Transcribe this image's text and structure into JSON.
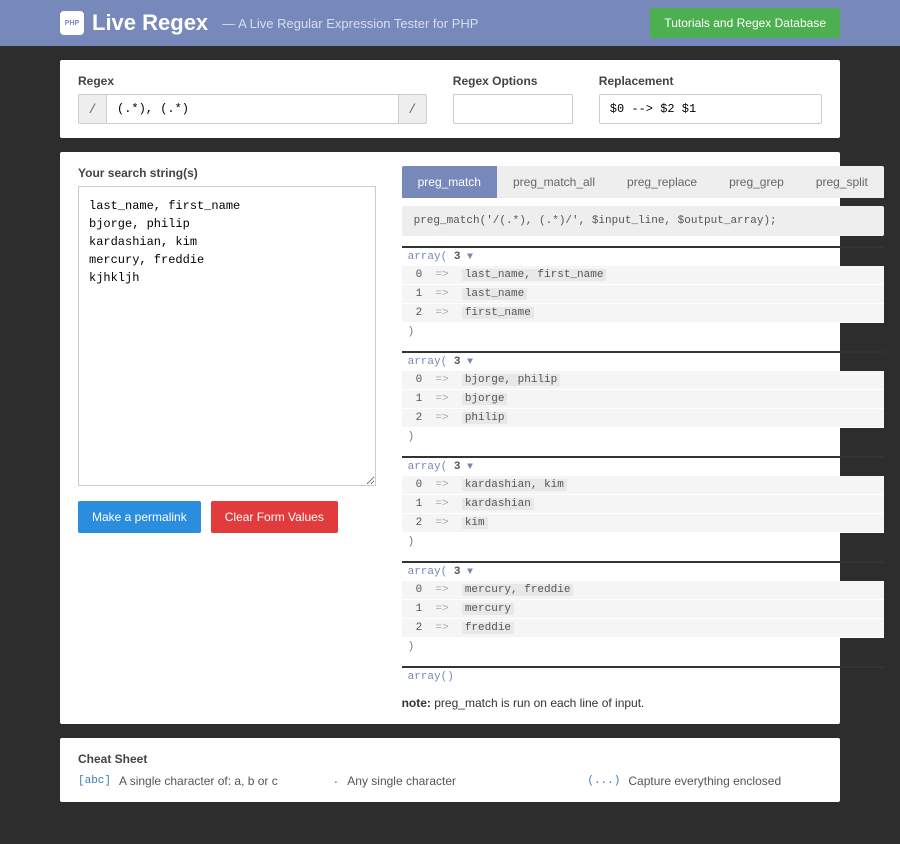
{
  "header": {
    "logo_text": "PHP",
    "title": "Live Regex",
    "subtitle": "— A Live Regular Expression Tester for PHP",
    "button": "Tutorials and Regex Database"
  },
  "inputs": {
    "regex_label": "Regex",
    "regex_value": "(.*), (.*)",
    "slash": "/",
    "options_label": "Regex Options",
    "options_value": "",
    "replacement_label": "Replacement",
    "replacement_value": "$0 --> $2 $1"
  },
  "search": {
    "label": "Your search string(s)",
    "value": "last_name, first_name\nbjorge, philip\nkardashian, kim\nmercury, freddie\nkjhkljh"
  },
  "buttons": {
    "permalink": "Make a permalink",
    "clear": "Clear Form Values"
  },
  "tabs": [
    {
      "label": "preg_match",
      "active": true
    },
    {
      "label": "preg_match_all",
      "active": false
    },
    {
      "label": "preg_replace",
      "active": false
    },
    {
      "label": "preg_grep",
      "active": false
    },
    {
      "label": "preg_split",
      "active": false
    }
  ],
  "code": "preg_match('/(.*), (.*)/', $input_line, $output_array);",
  "results": [
    {
      "count": "3",
      "rows": [
        {
          "i": "0",
          "v": "last_name, first_name"
        },
        {
          "i": "1",
          "v": "last_name"
        },
        {
          "i": "2",
          "v": "first_name"
        }
      ]
    },
    {
      "count": "3",
      "rows": [
        {
          "i": "0",
          "v": "bjorge, philip"
        },
        {
          "i": "1",
          "v": "bjorge"
        },
        {
          "i": "2",
          "v": "philip"
        }
      ]
    },
    {
      "count": "3",
      "rows": [
        {
          "i": "0",
          "v": "kardashian, kim"
        },
        {
          "i": "1",
          "v": "kardashian"
        },
        {
          "i": "2",
          "v": "kim"
        }
      ]
    },
    {
      "count": "3",
      "rows": [
        {
          "i": "0",
          "v": "mercury, freddie"
        },
        {
          "i": "1",
          "v": "mercury"
        },
        {
          "i": "2",
          "v": "freddie"
        }
      ]
    }
  ],
  "empty_array_label": "array()",
  "array_label": "array(",
  "arrow": "=>",
  "note_bold": "note:",
  "note_text": " preg_match is run on each line of input.",
  "cheat": {
    "title": "Cheat Sheet",
    "items": [
      {
        "code": "[abc]",
        "desc": "A single character of: a, b or c"
      },
      {
        "code": ".",
        "desc": "Any single character"
      },
      {
        "code": "(...)",
        "desc": "Capture everything enclosed"
      }
    ]
  }
}
